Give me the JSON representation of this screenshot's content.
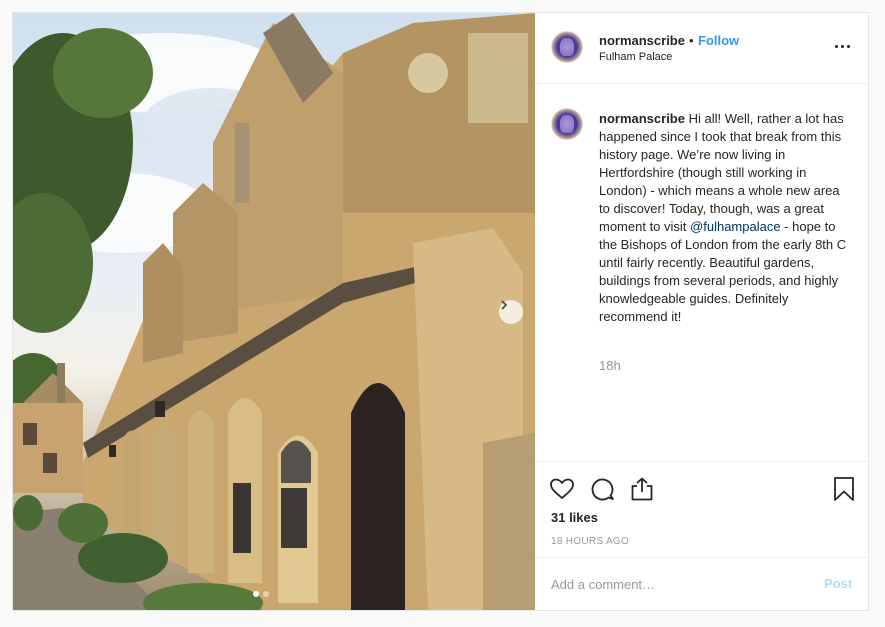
{
  "post": {
    "username": "normanscribe",
    "bullet": "•",
    "follow_label": "Follow",
    "location": "Fulham Palace",
    "caption": {
      "username": "normanscribe",
      "text_before_mention": "Hi all! Well, rather a lot has happened since I took that break from this history page. We’re now living in Hertfordshire (though still working in London) - which means a whole new area to discover! Today, though, was a great moment to visit ",
      "mention": "@fulhampalace",
      "text_after_mention": " - hope to the Bishops of London from the early 8th C until fairly recently. Beautiful gardens, buildings from several periods, and highly knowledgeable guides. Definitely recommend it!",
      "time": "18h"
    },
    "likes": "31 likes",
    "timestamp": "18 HOURS AGO",
    "comment_placeholder": "Add a comment…",
    "post_label": "Post",
    "icons": {
      "more": "more-options-icon",
      "like": "heart-icon",
      "comment": "comment-bubble-icon",
      "share": "share-icon",
      "save": "bookmark-icon",
      "next": "chevron-right-icon"
    },
    "colors": {
      "link": "#3897f0",
      "post_disabled": "#b3dbff",
      "muted": "#999999",
      "text": "#262626"
    },
    "carousel": {
      "total": 2,
      "current": 1
    }
  }
}
